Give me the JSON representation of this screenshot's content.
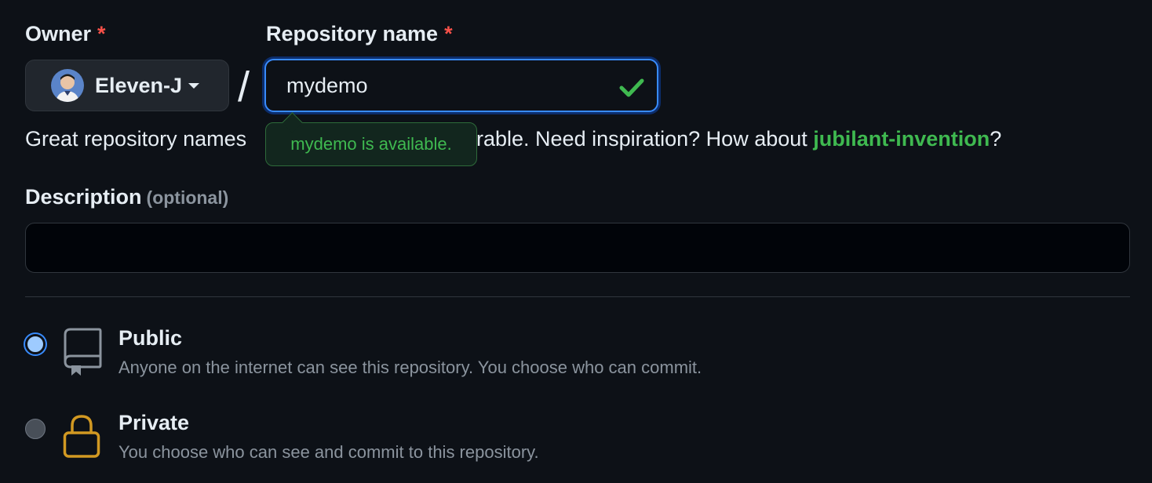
{
  "owner": {
    "label": "Owner",
    "required_mark": "*",
    "selected": "Eleven-J"
  },
  "separator": "/",
  "repo_name": {
    "label": "Repository name",
    "required_mark": "*",
    "value": "mydemo",
    "status": "valid"
  },
  "availability_tooltip": "mydemo is available.",
  "hint": {
    "visible_start": "Great repository names",
    "visible_end": "rable. Need inspiration? How about",
    "suggestion": "jubilant-invention",
    "trailing": "?"
  },
  "description": {
    "label": "Description",
    "optional_label": "(optional)",
    "value": ""
  },
  "visibility": {
    "selected": "public",
    "options": [
      {
        "id": "public",
        "title": "Public",
        "description": "Anyone on the internet can see this repository. You choose who can commit.",
        "icon": "repo-icon"
      },
      {
        "id": "private",
        "title": "Private",
        "description": "You choose who can see and commit to this repository.",
        "icon": "lock-icon"
      }
    ]
  },
  "colors": {
    "background": "#0d1117",
    "accent_blue": "#388bfd",
    "success_green": "#3fb950",
    "danger_red": "#f85149",
    "muted_text": "#8b949e",
    "lock_yellow": "#d29922"
  }
}
